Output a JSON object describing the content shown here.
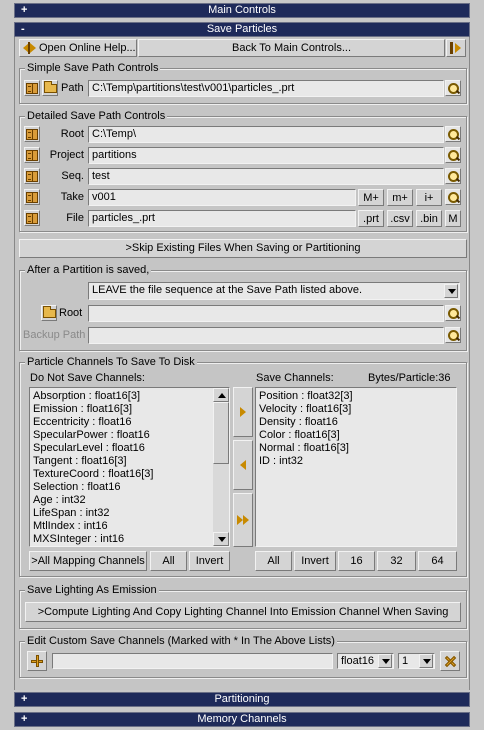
{
  "rollouts": {
    "main_controls": {
      "sign": "+",
      "label": "Main Controls"
    },
    "save_particles": {
      "sign": "-",
      "label": "Save Particles"
    },
    "partitioning": {
      "sign": "+",
      "label": "Partitioning"
    },
    "memory_channels": {
      "sign": "+",
      "label": "Memory Channels"
    }
  },
  "top_buttons": {
    "open_help": "Open Online Help...",
    "back_to_main": "Back To Main Controls..."
  },
  "simple_path": {
    "title": "Simple Save Path Controls",
    "path_label": "Path",
    "path_value": "C:\\Temp\\partitions\\test\\v001\\particles_.prt"
  },
  "detailed_path": {
    "title": "Detailed Save Path Controls",
    "root_label": "Root",
    "root_value": "C:\\Temp\\",
    "project_label": "Project",
    "project_value": "partitions",
    "seq_label": "Seq.",
    "seq_value": "test",
    "take_label": "Take",
    "take_value": "v001",
    "take_buttons": [
      "M+",
      "m+",
      "i+"
    ],
    "file_label": "File",
    "file_value": "particles_.prt",
    "file_buttons": [
      ".prt",
      ".csv",
      ".bin",
      "M"
    ]
  },
  "skip_existing": ">Skip Existing Files When Saving or Partitioning",
  "after_partition": {
    "title": "After a Partition is saved,",
    "option_value": "LEAVE the file sequence at the Save Path listed above.",
    "root_label": "Root",
    "root_value": "",
    "backup_label": "Backup Path",
    "backup_value": ""
  },
  "channels": {
    "title": "Particle Channels To Save To Disk",
    "do_not_save_label": "Do Not Save Channels:",
    "save_label": "Save Channels:",
    "bytes_label": "Bytes/Particle:36",
    "do_not_save": [
      "Absorption  : float16[3]",
      "Emission  : float16[3]",
      "Eccentricity  : float16",
      "SpecularPower  : float16",
      "SpecularLevel  : float16",
      "Tangent  : float16[3]",
      "TextureCoord  : float16[3]",
      "Selection  : float16",
      "Age  : int32",
      "LifeSpan  : int32",
      "MtlIndex  : int16",
      "MXSInteger  : int16"
    ],
    "save": [
      "Position  : float32[3]",
      "Velocity  : float16[3]",
      "Density  : float16",
      "Color  : float16[3]",
      "Normal  : float16[3]",
      "ID  : int32"
    ],
    "left_buttons": [
      ">All Mapping Channels",
      "All",
      "Invert"
    ],
    "right_buttons": [
      "All",
      "Invert",
      "16",
      "32",
      "64"
    ]
  },
  "lighting": {
    "title": "Save Lighting As Emission",
    "button": ">Compute Lighting And Copy Lighting Channel Into Emission Channel When Saving"
  },
  "custom": {
    "title": "Edit Custom Save Channels (Marked with * In The Above Lists)",
    "name_value": "",
    "type_value": "float16",
    "arity_value": "1"
  }
}
